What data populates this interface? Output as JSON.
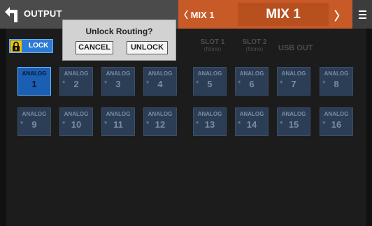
{
  "header": {
    "title": "OUTPUT",
    "prev_label": "〈 MIX 1",
    "mix_label": "MIX 1",
    "next_label": "〉"
  },
  "lock": {
    "label": "LOCK"
  },
  "tabs": [
    {
      "line1": "SLOT 1",
      "line2": "(None)"
    },
    {
      "line1": "SLOT 2",
      "line2": "(None)"
    },
    {
      "line1": "USB OUT",
      "line2": ""
    }
  ],
  "channels": {
    "row1": [
      {
        "label": "ANALOG",
        "num": "1",
        "star": "",
        "selected": true
      },
      {
        "label": "ANALOG",
        "num": "2",
        "star": "*"
      },
      {
        "label": "ANALOG",
        "num": "3",
        "star": "*"
      },
      {
        "label": "ANALOG",
        "num": "4",
        "star": "*"
      },
      {
        "label": "ANALOG",
        "num": "5",
        "star": "*"
      },
      {
        "label": "ANALOG",
        "num": "6",
        "star": "*"
      },
      {
        "label": "ANALOG",
        "num": "7",
        "star": "*"
      },
      {
        "label": "ANALOG",
        "num": "8",
        "star": "*"
      }
    ],
    "row2": [
      {
        "label": "ANALOG",
        "num": "9",
        "star": "*"
      },
      {
        "label": "ANALOG",
        "num": "10",
        "star": "*"
      },
      {
        "label": "ANALOG",
        "num": "11",
        "star": "*"
      },
      {
        "label": "ANALOG",
        "num": "12",
        "star": "*"
      },
      {
        "label": "ANALOG",
        "num": "13",
        "star": "*"
      },
      {
        "label": "ANALOG",
        "num": "14",
        "star": "*"
      },
      {
        "label": "ANALOG",
        "num": "15",
        "star": "*"
      },
      {
        "label": "ANALOG",
        "num": "16",
        "star": "*"
      }
    ]
  },
  "dialog": {
    "title": "Unlock Routing?",
    "cancel_label": "CANCEL",
    "unlock_label": "UNLOCK"
  },
  "icons": {
    "back": "back-arrow-icon",
    "lock": "padlock-icon",
    "menu": "hamburger-menu-icon"
  },
  "colors": {
    "header_accent": "#c85a28",
    "selected_channel": "#1a5fb4",
    "lock_button": "#2e7bd4",
    "lock_icon": "#f2c300"
  }
}
